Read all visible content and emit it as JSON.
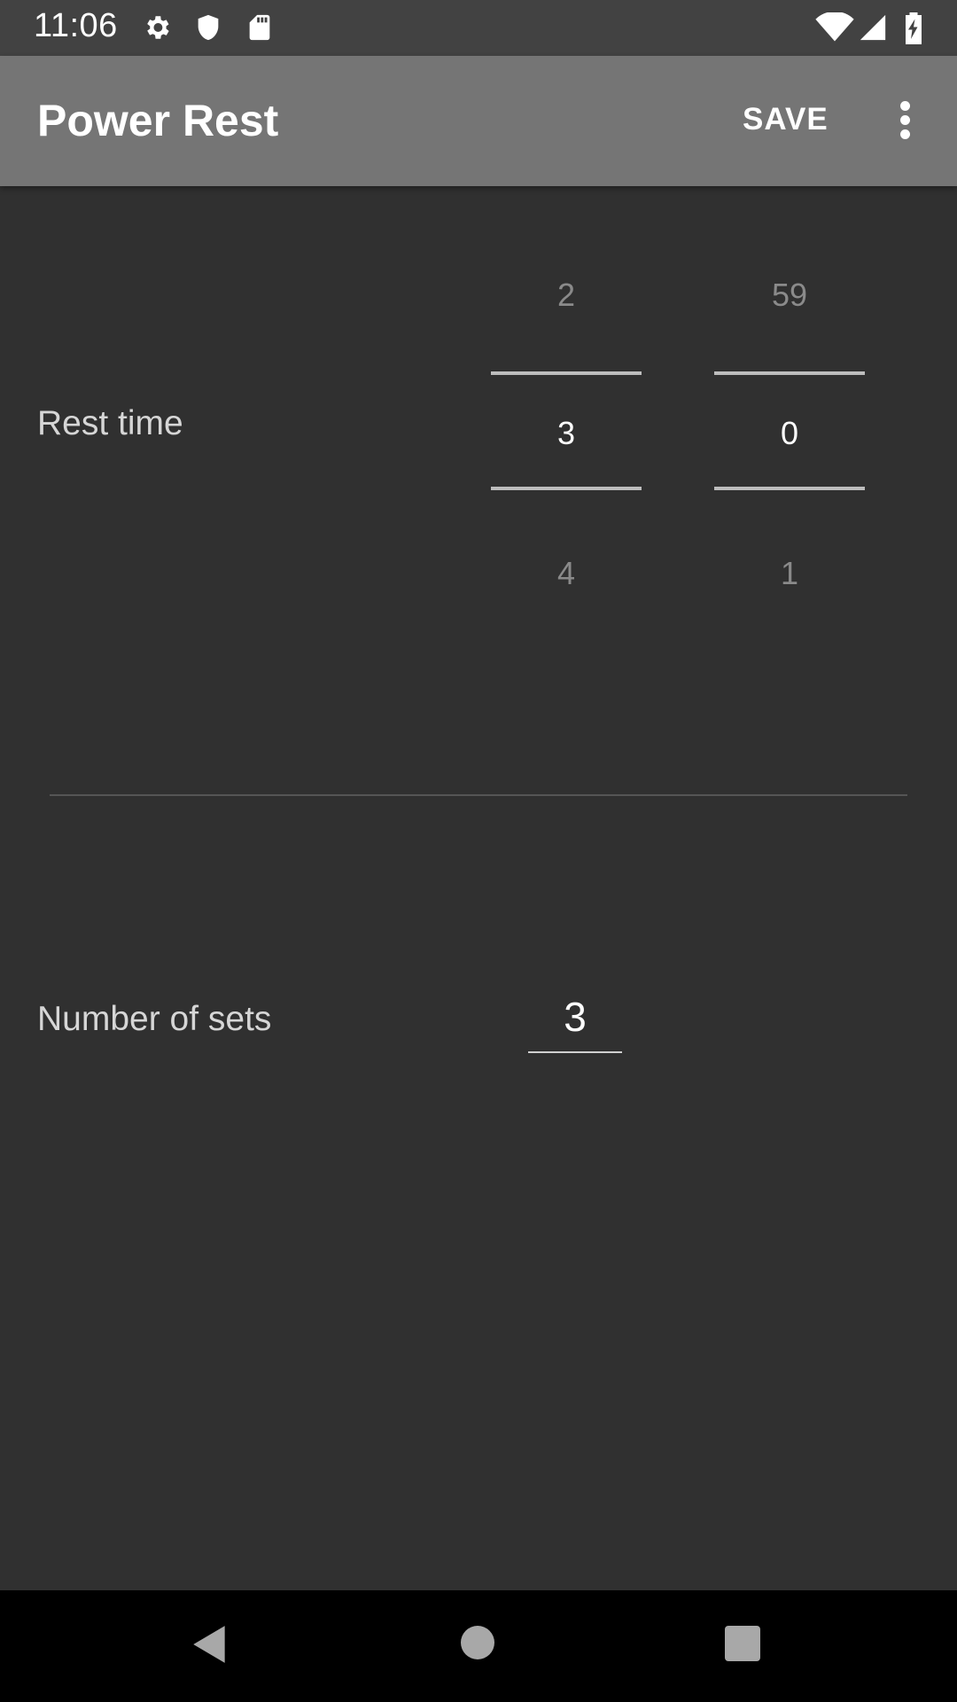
{
  "status_bar": {
    "time": "11:06",
    "icons": [
      "gear-icon",
      "shield-icon",
      "sd-card-icon",
      "wifi-icon",
      "signal-icon",
      "battery-charging-icon"
    ]
  },
  "app_bar": {
    "title": "Power Rest",
    "save_label": "SAVE",
    "overflow_icon": "more-vert-icon",
    "background": "#757575"
  },
  "rest_time": {
    "label": "Rest time",
    "minutes": {
      "prev": "2",
      "current": "3",
      "next": "4"
    },
    "seconds": {
      "prev": "59",
      "current": "0",
      "next": "1"
    }
  },
  "sets": {
    "label": "Number of sets",
    "value": "3"
  },
  "nav_bar": {
    "icons": [
      "back-icon",
      "home-icon",
      "recents-icon"
    ]
  },
  "colors": {
    "background": "#303030",
    "status_bar": "#424242",
    "app_bar": "#757575"
  }
}
